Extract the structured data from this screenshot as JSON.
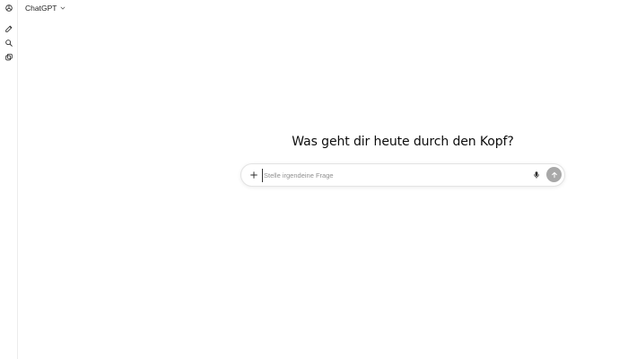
{
  "app": {
    "model_selector_label": "ChatGPT"
  },
  "sidebar": {
    "icons": [
      "openai-logo-icon",
      "new-chat-icon",
      "search-icon",
      "library-icon"
    ]
  },
  "main": {
    "headline": "Was geht dir heute durch den Kopf?"
  },
  "composer": {
    "value": "",
    "placeholder": "Stelle irgendeine Frage"
  },
  "colors": {
    "send_button_bg": "#a8a8a8",
    "border": "#e3e3e3",
    "text": "#0d0d0d"
  }
}
